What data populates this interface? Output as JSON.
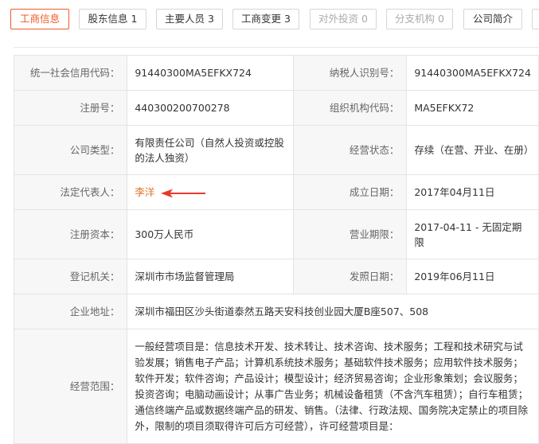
{
  "tabs": [
    {
      "label": "工商信息",
      "count": "",
      "state": "active"
    },
    {
      "label": "股东信息",
      "count": "1",
      "state": "normal"
    },
    {
      "label": "主要人员",
      "count": "3",
      "state": "normal"
    },
    {
      "label": "工商变更",
      "count": "3",
      "state": "normal"
    },
    {
      "label": "对外投资",
      "count": "0",
      "state": "disabled"
    },
    {
      "label": "分支机构",
      "count": "0",
      "state": "disabled"
    },
    {
      "label": "公司简介",
      "count": "",
      "state": "normal"
    }
  ],
  "info": {
    "credit_code_label": "统一社会信用代码：",
    "credit_code": "91440300MA5EFKX724",
    "taxpayer_id_label": "纳税人识别号：",
    "taxpayer_id": "91440300MA5EFKX724",
    "reg_no_label": "注册号：",
    "reg_no": "440300200700278",
    "org_code_label": "组织机构代码：",
    "org_code": "MA5EFKX72",
    "company_type_label": "公司类型：",
    "company_type": "有限责任公司（自然人投资或控股的法人独资）",
    "status_label": "经营状态：",
    "status": "存续（在营、开业、在册）",
    "legal_rep_label": "法定代表人：",
    "legal_rep": "李洋",
    "est_date_label": "成立日期：",
    "est_date": "2017年04月11日",
    "capital_label": "注册资本：",
    "capital": "300万人民币",
    "term_label": "营业期限：",
    "term": "2017-04-11 - 无固定期限",
    "authority_label": "登记机关：",
    "authority": "深圳市市场监督管理局",
    "issue_date_label": "发照日期：",
    "issue_date": "2019年06月11日",
    "address_label": "企业地址：",
    "address": "深圳市福田区沙头街道泰然五路天安科技创业园大厦B座507、508",
    "scope_label": "经营范围：",
    "scope": "一般经营项目是：信息技术开发、技术转让、技术咨询、技术服务；工程和技术研究与试验发展；销售电子产品；计算机系统技术服务；基础软件技术服务；应用软件技术服务；软件开发；软件咨询；产品设计；模型设计；经济贸易咨询；企业形象策划；会议服务；投资咨询；电脑动画设计；从事广告业务；机械设备租赁（不含汽车租赁）；自行车租赁；通信终端产品或数据终端产品的研发、销售。（法律、行政法规、国务院决定禁止的项目除外，限制的项目须取得许可后方可经营），许可经营项目是："
  },
  "colors": {
    "accent": "#f05a28",
    "link": "#e0742a",
    "label_bg": "#f7f7f7",
    "border": "#e4e4e4"
  },
  "icons": {
    "pointer": "red-arrow-icon"
  }
}
